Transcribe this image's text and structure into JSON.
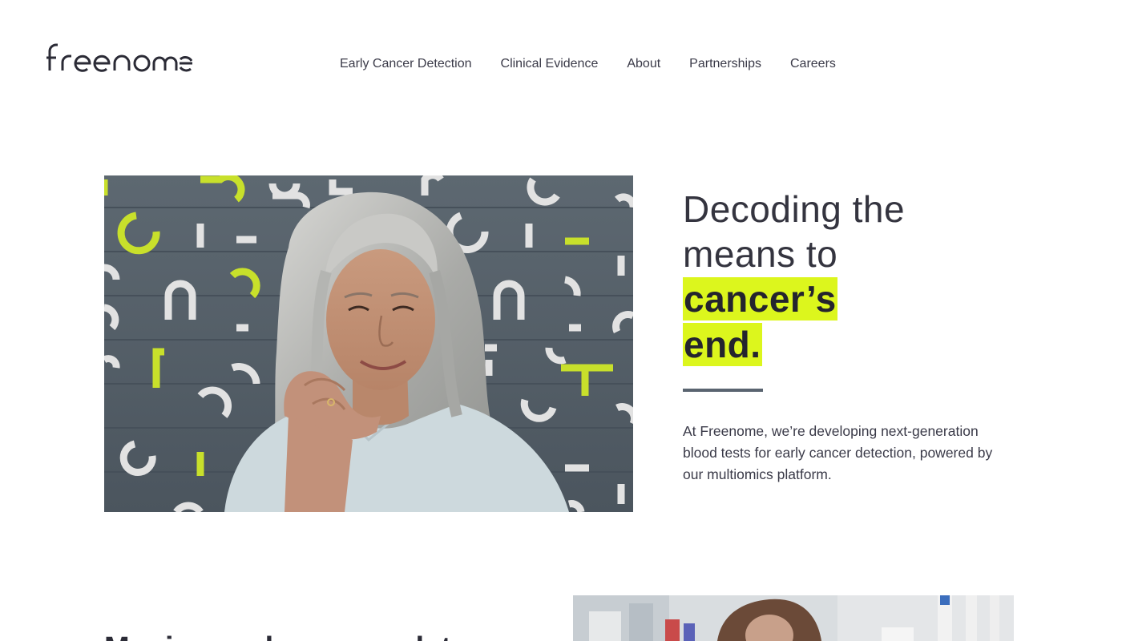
{
  "header": {
    "logo_text": "freenome",
    "nav": [
      {
        "label": "Early Cancer Detection"
      },
      {
        "label": "Clinical Evidence"
      },
      {
        "label": "About"
      },
      {
        "label": "Partnerships"
      },
      {
        "label": "Careers"
      }
    ]
  },
  "hero": {
    "headline_line1": "Decoding the",
    "headline_line2": "means to",
    "headline_highlight1": "cancer’s",
    "headline_highlight2": "end.",
    "description": "At Freenome, we’re developing next-generation blood tests for early cancer detection, powered by our multiomics platform.",
    "image_alt": "smiling woman with gray hair",
    "accent_color": "#dcf61d"
  },
  "next_section": {
    "heading": "Moving early cancer detection"
  }
}
